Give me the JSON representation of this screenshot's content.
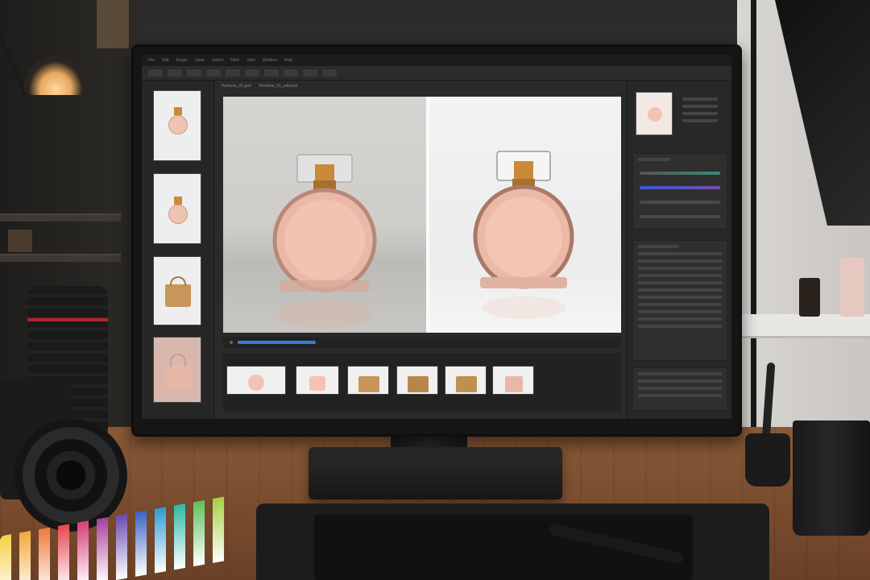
{
  "app": {
    "menu_items": [
      "File",
      "Edit",
      "Image",
      "Layer",
      "Select",
      "Filter",
      "View",
      "Window",
      "Help"
    ],
    "document_tabs": [
      "Perfume_01.psd",
      "Perfume_01_edit.psd"
    ]
  },
  "canvas": {
    "before_label": "",
    "after_label": "",
    "progress": 0.54
  },
  "side_thumbnails": [
    {
      "kind": "perfume-bottle"
    },
    {
      "kind": "perfume-bottle"
    },
    {
      "kind": "handbag"
    },
    {
      "kind": "handbag-pink"
    }
  ],
  "bottom_thumbnails": [
    {
      "kind": "perfume-bottle"
    },
    {
      "kind": "perfume-bottle"
    },
    {
      "kind": "handbag"
    },
    {
      "kind": "handbag"
    },
    {
      "kind": "handbag"
    },
    {
      "kind": "handbag-pink"
    }
  ],
  "colors": {
    "accent": "#3a7bd5",
    "perfume_liquid": "#f1c4b2",
    "cap_gold": "#c98a3a",
    "bag_tan": "#c8965a",
    "swatch": [
      "#f7d046",
      "#f2a93b",
      "#ee7a3c",
      "#e5484d",
      "#d63d7a",
      "#a63f9e",
      "#6a4ab0",
      "#3a63c4",
      "#2f9bd6",
      "#2fb8a6",
      "#5cbf5a",
      "#a6cf45"
    ]
  }
}
